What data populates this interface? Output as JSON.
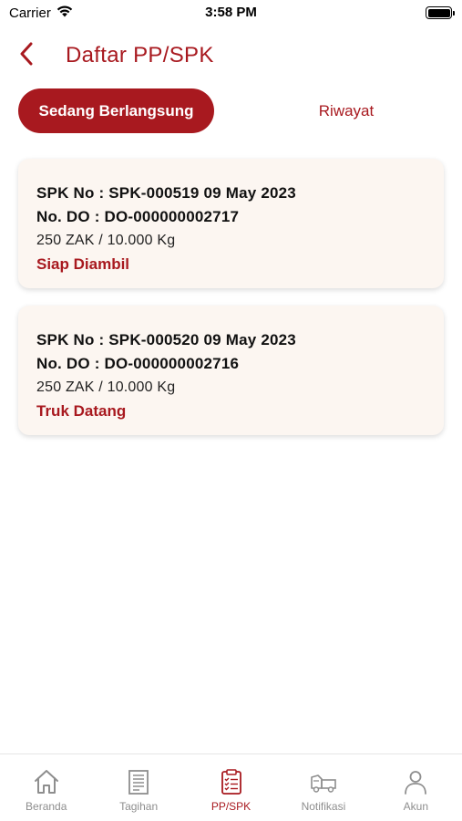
{
  "status_bar": {
    "carrier": "Carrier",
    "time": "3:58 PM"
  },
  "header": {
    "title": "Daftar PP/SPK"
  },
  "tabs": [
    {
      "label": "Sedang Berlangsung",
      "active": true
    },
    {
      "label": "Riwayat",
      "active": false
    }
  ],
  "orders": [
    {
      "spk": "SPK No : SPK-000519 09 May 2023",
      "do": "No. DO : DO-000000002717",
      "qty": "250 ZAK / 10.000 Kg",
      "status": "Siap Diambil"
    },
    {
      "spk": "SPK No : SPK-000520 09 May 2023",
      "do": "No. DO : DO-000000002716",
      "qty": "250 ZAK / 10.000 Kg",
      "status": "Truk Datang"
    }
  ],
  "nav": [
    {
      "label": "Beranda",
      "icon": "home-icon",
      "active": false
    },
    {
      "label": "Tagihan",
      "icon": "invoice-icon",
      "active": false
    },
    {
      "label": "PP/SPK",
      "icon": "clipboard-icon",
      "active": true
    },
    {
      "label": "Notifikasi",
      "icon": "truck-icon",
      "active": false
    },
    {
      "label": "Akun",
      "icon": "user-icon",
      "active": false
    }
  ],
  "colors": {
    "accent": "#a8191f",
    "card_bg": "#fcf6f1",
    "nav_inactive": "#8e8e8e"
  }
}
